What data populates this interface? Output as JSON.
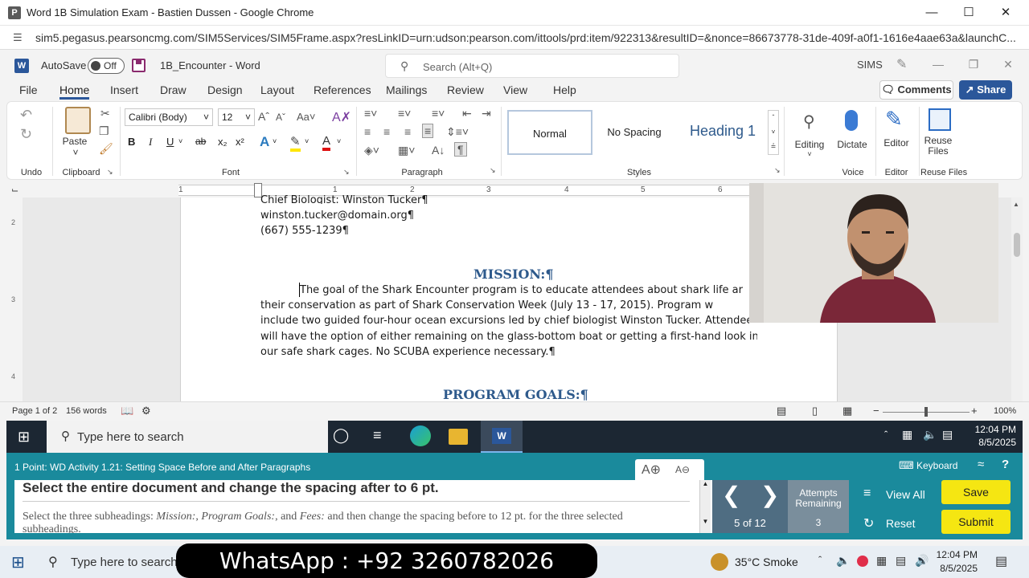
{
  "chrome": {
    "favicon_letter": "P",
    "title": "Word 1B Simulation Exam - Bastien Dussen - Google Chrome",
    "url": "sim5.pegasus.pearsoncmg.com/SIM5Services/SIM5Frame.aspx?resLinkID=urn:udson:pearson.com/ittools/prd:item/922313&resultID=&nonce=86673778-31de-409f-a0f1-1616e4aae63a&launchC..."
  },
  "word": {
    "logo_letter": "W",
    "autosave_label": "AutoSave",
    "autosave_state": "Off",
    "doc_name": "1B_Encounter  -  Word",
    "search_placeholder": "Search (Alt+Q)",
    "user": "SIMS"
  },
  "ribbon_tabs": [
    "File",
    "Home",
    "Insert",
    "Draw",
    "Design",
    "Layout",
    "References",
    "Mailings",
    "Review",
    "View",
    "Help"
  ],
  "ribbon": {
    "comments": "Comments",
    "share": "Share",
    "paste": "Paste",
    "font_name": "Calibri (Body)",
    "font_size": "12",
    "groups": {
      "undo": "Undo",
      "clipboard": "Clipboard",
      "font": "Font",
      "paragraph": "Paragraph",
      "styles": "Styles",
      "voice": "Voice",
      "editor": "Editor",
      "reuse": "Reuse Files"
    },
    "styles": [
      "Normal",
      "No Spacing",
      "Heading 1"
    ],
    "editing": "Editing",
    "dictate": "Dictate",
    "editor": "Editor",
    "reuse_files": "Reuse\nFiles"
  },
  "ruler_numbers": [
    "1",
    "1",
    "2",
    "3",
    "4",
    "5",
    "6"
  ],
  "document": {
    "line_cut": "Chief Biologist: Winston Tucker¶",
    "email": "winston.tucker@domain.org¶",
    "phone": "(667) 555-1239¶",
    "mission_heading": "MISSION:¶",
    "para_lines": [
      "The goal of the Shark Encounter program is to educate attendees about shark life ar",
      "their conservation as part of Shark Conservation Week (July 13 - 17, 2015). Program w",
      "include two guided four-hour ocean excursions led by chief biologist Winston Tucker. Attendees",
      "will have the option of either remaining on the glass-bottom boat or getting a first-hand look in",
      "our safe shark cages. No SCUBA experience necessary.¶"
    ],
    "goals_heading": "PROGRAM GOALS:¶"
  },
  "statusbar": {
    "page": "Page 1 of 2",
    "words": "156 words",
    "zoom": "100%",
    "zoom_level": 100
  },
  "taskbar1": {
    "search_placeholder": "Type here to search",
    "time": "12:04 PM",
    "date": "8/5/2025"
  },
  "sim": {
    "task_title": "1 Point: WD Activity 1.21: Setting Space Before and After Paragraphs",
    "keyboard": "Keyboard",
    "question": "Select the entire document and change the spacing after to 6 pt.",
    "next_question_parts": [
      "Select the three subheadings: ",
      "Mission:",
      ", ",
      "Program Goals:",
      ", and ",
      "Fees:",
      " and then change the spacing before to 12 pt. for the three selected subheadings."
    ],
    "progress": "5 of 12",
    "attempts_label": "Attempts\nRemaining",
    "attempts": "3",
    "view_all": "View All",
    "reset": "Reset",
    "save": "Save",
    "submit": "Submit"
  },
  "taskbar2": {
    "search_placeholder": "Type here to search",
    "weather": "35°C  Smoke",
    "time": "12:04 PM",
    "date": "8/5/2025"
  },
  "overlay": {
    "text": "WhatsApp : +92 3260782026"
  }
}
